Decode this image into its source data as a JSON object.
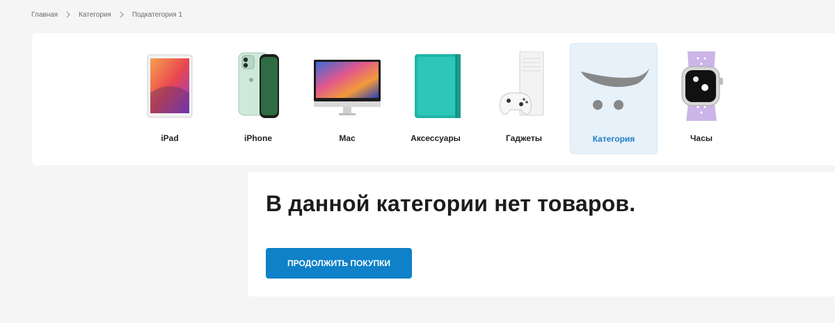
{
  "breadcrumb": {
    "items": [
      "Главная",
      "Категория",
      "Подкатегория 1"
    ]
  },
  "categories": [
    {
      "label": "iPad",
      "icon": "ipad-image"
    },
    {
      "label": "iPhone",
      "icon": "iphone-image"
    },
    {
      "label": "Mac",
      "icon": "mac-image"
    },
    {
      "label": "Аксессуары",
      "icon": "accessories-case-image"
    },
    {
      "label": "Гаджеты",
      "icon": "xbox-console-image"
    },
    {
      "label": "Категория",
      "icon": "opencart-cart-logo",
      "active": true
    },
    {
      "label": "Часы",
      "icon": "watch-image"
    }
  ],
  "content": {
    "title": "В данной категории нет товаров.",
    "button_label": "ПРОДОЛЖИТЬ ПОКУПКИ"
  },
  "colors": {
    "accent": "#0e81c8",
    "active_bg": "#e6f1fa",
    "active_text": "#1f7dc1",
    "page_bg": "#f5f5f5"
  }
}
